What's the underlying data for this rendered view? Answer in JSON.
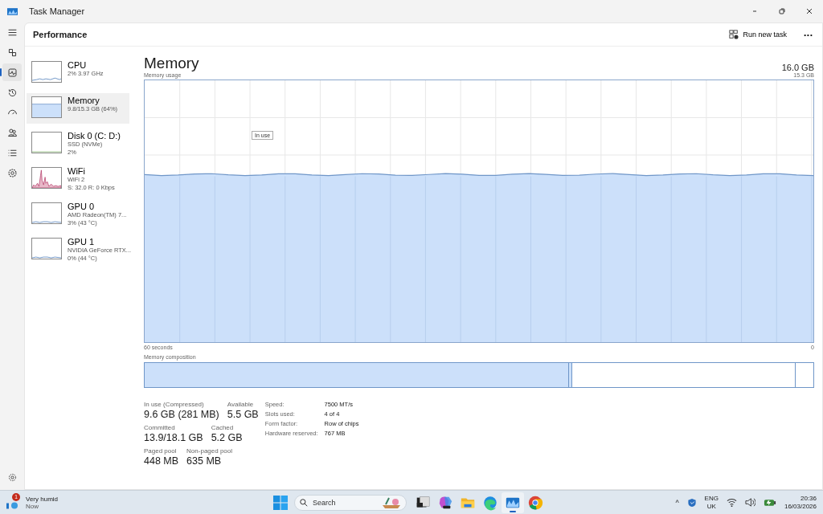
{
  "window": {
    "title": "Task Manager"
  },
  "nav": [
    {
      "selected": false
    },
    {
      "selected": false
    },
    {
      "selected": true
    },
    {
      "selected": false
    },
    {
      "selected": false
    },
    {
      "selected": false
    },
    {
      "selected": false
    },
    {
      "selected": false
    }
  ],
  "header": {
    "title": "Performance",
    "run_task": "Run new task",
    "more": "•••"
  },
  "sidebar": {
    "items": [
      {
        "kind": "cpu",
        "name": "CPU",
        "lines": [
          "2% 3.97 GHz"
        ],
        "selected": false
      },
      {
        "kind": "memory",
        "name": "Memory",
        "lines": [
          "9.8/15.3 GB (64%)"
        ],
        "selected": true
      },
      {
        "kind": "disk",
        "name": "Disk 0 (C: D:)",
        "lines": [
          "SSD (NVMe)",
          "2%"
        ],
        "selected": false
      },
      {
        "kind": "wifi",
        "name": "WiFi",
        "lines": [
          "WiFi 2",
          "S: 32.0 R: 0 Kbps"
        ],
        "selected": false
      },
      {
        "kind": "gpu",
        "name": "GPU 0",
        "lines": [
          "AMD Radeon(TM) 7...",
          "3% (43 °C)"
        ],
        "selected": false
      },
      {
        "kind": "gpu",
        "name": "GPU 1",
        "lines": [
          "NVIDIA GeForce RTX...",
          "0% (44 °C)"
        ],
        "selected": false
      }
    ]
  },
  "main": {
    "title": "Memory",
    "total": "16.0 GB",
    "graph_label": "Memory usage",
    "graph_max": "15.3 GB",
    "tooltip": "In use",
    "x_start": "60 seconds",
    "x_end": "0",
    "composition_label": "Memory composition",
    "stats": [
      [
        {
          "label": "In use (Compressed)",
          "value": "9.6 GB (281 MB)"
        },
        {
          "label": "Available",
          "value": "5.5 GB"
        }
      ],
      [
        {
          "label": "Committed",
          "value": "13.9/18.1 GB"
        },
        {
          "label": "Cached",
          "value": "5.2 GB"
        }
      ],
      [
        {
          "label": "Paged pool",
          "value": "448 MB"
        },
        {
          "label": "Non-paged pool",
          "value": "635 MB"
        }
      ]
    ],
    "details": [
      {
        "label": "Speed:",
        "value": "7500 MT/s"
      },
      {
        "label": "Slots used:",
        "value": "4 of 4"
      },
      {
        "label": "Form factor:",
        "value": "Row of chips"
      },
      {
        "label": "Hardware reserved:",
        "value": "767 MB"
      }
    ]
  },
  "taskbar": {
    "weather": {
      "badge": "1",
      "title": "Very humid",
      "subtitle": "Now"
    },
    "search": {
      "placeholder": "Search"
    },
    "apps": [
      {
        "selected": false
      },
      {
        "selected": false
      },
      {
        "selected": false
      },
      {
        "selected": false
      },
      {
        "selected": true
      },
      {
        "selected": false
      }
    ],
    "tray": {
      "chevron": "^",
      "lang": "ENG",
      "region": "UK",
      "time": "20:36",
      "date": "16/03/2026"
    }
  }
}
